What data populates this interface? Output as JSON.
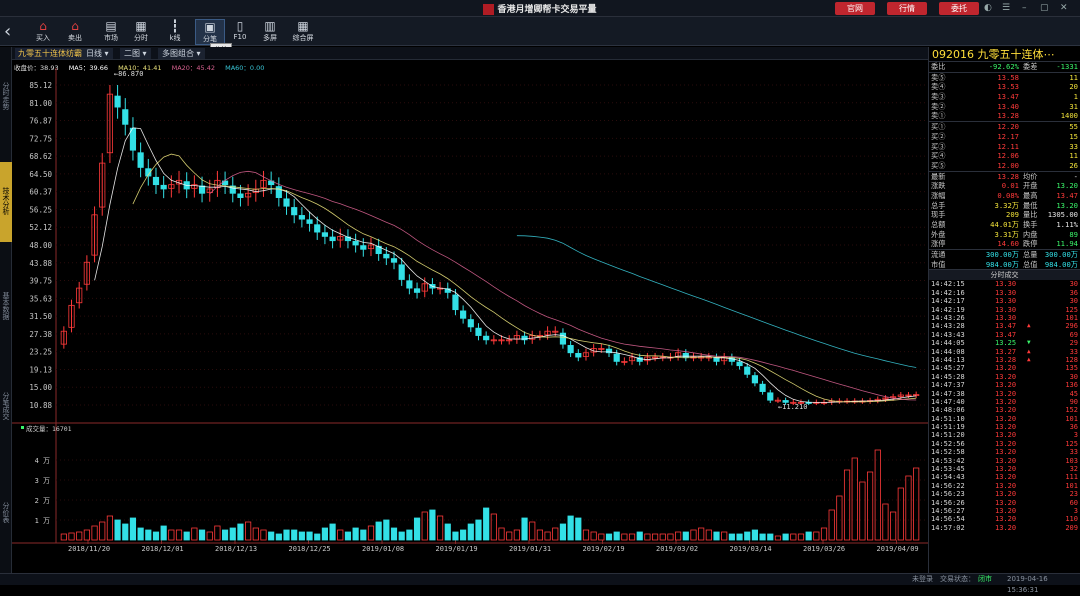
{
  "window": {
    "title": "香港月增卿帮卡交易平量",
    "buttons": [
      "官网",
      "行情",
      "委托"
    ],
    "controls": [
      "◐",
      "☰",
      "–",
      "▢",
      "✕"
    ]
  },
  "toolbar": {
    "items": [
      {
        "label": "买入",
        "icon": "buy-icon",
        "glyph": "⌂"
      },
      {
        "label": "卖出",
        "icon": "sell-icon",
        "glyph": "⌂"
      },
      {
        "label": "市场",
        "icon": "market-icon",
        "glyph": "▤"
      },
      {
        "label": "分时",
        "icon": "timeshare-icon",
        "glyph": "▦"
      },
      {
        "label": "k线",
        "icon": "kline-icon",
        "glyph": "┇"
      },
      {
        "label": "分笔",
        "icon": "tick-icon",
        "glyph": "▣"
      },
      {
        "label": "F10",
        "icon": "f10-icon",
        "glyph": "▯"
      },
      {
        "label": "多屏",
        "icon": "multiscreen-icon",
        "glyph": "▥"
      },
      {
        "label": "综合屏",
        "icon": "dashboard-icon",
        "glyph": "▦"
      }
    ],
    "tooltip": "分笔"
  },
  "leftnav": [
    "分时走势",
    "技术分析",
    "基本数据",
    "分笔成交",
    "分价表"
  ],
  "chart_tabs": {
    "stock": "九零五十连体纺霸",
    "period": "日线",
    "layout": "二图",
    "combo": "多图组合"
  },
  "legend": {
    "price": "收盘价：38.93",
    "ma5": "MA5：39.66",
    "ma10": "MA10：41.41",
    "ma20": "MA20：45.42",
    "ma60": "MA60：0.00",
    "volume": "成交量：16701"
  },
  "colors": {
    "up": "#ff3a3a",
    "down": "#33e0e6",
    "ma5": "#ffffff",
    "ma10": "#e8e07a",
    "ma20": "#d6618f",
    "ma60": "#39c6d6"
  },
  "chart_data": {
    "type": "candlestick",
    "price_ticks": [
      "85.12",
      "81.00",
      "76.87",
      "72.75",
      "68.62",
      "64.50",
      "60.37",
      "56.25",
      "52.12",
      "48.00",
      "43.88",
      "39.75",
      "35.63",
      "31.50",
      "27.38",
      "23.25",
      "19.13",
      "15.00",
      "10.88"
    ],
    "volume_ticks": [
      "4 万",
      "3 万",
      "2 万",
      "1 万"
    ],
    "date_ticks": [
      "2018/11/20",
      "2018/12/01",
      "2018/12/13",
      "2018/12/25",
      "2019/01/08",
      "2019/01/19",
      "2019/01/31",
      "2019/02/19",
      "2019/03/02",
      "2019/03/14",
      "2019/03/26",
      "2019/04/09"
    ],
    "annotations": {
      "high": "←86.870",
      "low": "←11.210"
    },
    "ylim": [
      10.88,
      85.12
    ],
    "closes": [
      28,
      34,
      38,
      44,
      55,
      67,
      83,
      80,
      76,
      70,
      66,
      64,
      62,
      61,
      62,
      63,
      61,
      62,
      60,
      61,
      63,
      62,
      60,
      59,
      60,
      61,
      63,
      62,
      59,
      57,
      55,
      54,
      53,
      51,
      50,
      49,
      50,
      49,
      48,
      47,
      48,
      46,
      45,
      44,
      40,
      38,
      37,
      39,
      38,
      38,
      37,
      33,
      31,
      29,
      27,
      26,
      26,
      26,
      26,
      27,
      26,
      27,
      27,
      28,
      28,
      25,
      23,
      22,
      23,
      24,
      24,
      23,
      21,
      21,
      22,
      21,
      22,
      22,
      22,
      22,
      23,
      22,
      22,
      22,
      22,
      21,
      22,
      21,
      20,
      18,
      16,
      14,
      12,
      12,
      11.5,
      11.5,
      11.5,
      11.3,
      11.5,
      11.5,
      11.8,
      11.8,
      11.8,
      11.8,
      11.8,
      11.9,
      12.2,
      12.5,
      12.8,
      13.2,
      13.2,
      13.3
    ],
    "volumes": [
      0.3,
      0.35,
      0.4,
      0.5,
      0.7,
      0.9,
      1.2,
      1.0,
      0.8,
      1.1,
      0.6,
      0.5,
      0.4,
      0.7,
      0.5,
      0.5,
      0.4,
      0.6,
      0.5,
      0.4,
      0.7,
      0.5,
      0.6,
      0.8,
      0.9,
      0.6,
      0.5,
      0.4,
      0.3,
      0.5,
      0.5,
      0.4,
      0.4,
      0.3,
      0.6,
      0.8,
      0.5,
      0.4,
      0.6,
      0.5,
      0.7,
      0.9,
      1.0,
      0.6,
      0.4,
      0.5,
      1.1,
      1.4,
      1.5,
      1.2,
      0.8,
      0.4,
      0.5,
      0.8,
      1.0,
      1.6,
      1.3,
      0.6,
      0.4,
      0.5,
      1.1,
      0.9,
      0.5,
      0.4,
      0.6,
      0.8,
      1.2,
      1.1,
      0.5,
      0.4,
      0.3,
      0.3,
      0.4,
      0.3,
      0.3,
      0.4,
      0.3,
      0.3,
      0.3,
      0.3,
      0.4,
      0.4,
      0.5,
      0.6,
      0.5,
      0.4,
      0.4,
      0.3,
      0.3,
      0.4,
      0.5,
      0.3,
      0.3,
      0.2,
      0.3,
      0.3,
      0.3,
      0.4,
      0.4,
      0.6,
      1.5,
      2.2,
      3.5,
      4.1,
      2.9,
      3.4,
      4.5,
      1.8,
      1.4,
      2.6,
      3.2,
      3.6
    ]
  },
  "right_panel": {
    "code_name": "092016 九零五十连体⋯",
    "weibi": {
      "label": "委比",
      "value": "-92.62%",
      "label2": "委差",
      "value2": "-1331"
    },
    "asks": [
      {
        "label": "卖⑤",
        "price": "13.58",
        "vol": "11"
      },
      {
        "label": "卖④",
        "price": "13.53",
        "vol": "20"
      },
      {
        "label": "卖③",
        "price": "13.47",
        "vol": "1"
      },
      {
        "label": "卖②",
        "price": "13.40",
        "vol": "31"
      },
      {
        "label": "卖①",
        "price": "13.28",
        "vol": "1400"
      }
    ],
    "bids": [
      {
        "label": "买①",
        "price": "12.20",
        "vol": "55"
      },
      {
        "label": "买②",
        "price": "12.17",
        "vol": "15"
      },
      {
        "label": "买③",
        "price": "12.11",
        "vol": "33"
      },
      {
        "label": "买④",
        "price": "12.06",
        "vol": "11"
      },
      {
        "label": "买⑤",
        "price": "12.00",
        "vol": "26"
      }
    ],
    "stats": [
      {
        "l1": "最新",
        "v1": "13.28",
        "c1": "r",
        "l2": "均价",
        "v2": "-",
        "c2": "w"
      },
      {
        "l1": "涨跌",
        "v1": "0.01",
        "c1": "r",
        "l2": "开盘",
        "v2": "13.20",
        "c2": "g"
      },
      {
        "l1": "涨幅",
        "v1": "0.08%",
        "c1": "r",
        "l2": "最高",
        "v2": "13.47",
        "c2": "r"
      },
      {
        "l1": "总手",
        "v1": "3.32万",
        "c1": "y",
        "l2": "最低",
        "v2": "13.20",
        "c2": "g"
      },
      {
        "l1": "现手",
        "v1": "209",
        "c1": "y",
        "l2": "量比",
        "v2": "1305.00",
        "c2": "w"
      },
      {
        "l1": "总额",
        "v1": "44.01万",
        "c1": "y",
        "l2": "换手",
        "v2": "1.11%",
        "c2": "w"
      },
      {
        "l1": "外盘",
        "v1": "3.31万",
        "c1": "y",
        "l2": "内盘",
        "v2": "89",
        "c2": "g"
      },
      {
        "l1": "涨停",
        "v1": "14.60",
        "c1": "r",
        "l2": "跌停",
        "v2": "11.94",
        "c2": "g"
      }
    ],
    "caps": [
      {
        "l1": "流通",
        "v1": "300.00万",
        "l2": "总量",
        "v2": "300.00万"
      },
      {
        "l1": "市值",
        "v1": "984.00万",
        "l2": "总值",
        "v2": "984.00万"
      }
    ],
    "ticks_title": "分时成交",
    "ticks": [
      {
        "t": "14:42:15",
        "p": "13.30",
        "v": "30",
        "a": ""
      },
      {
        "t": "14:42:16",
        "p": "13.30",
        "v": "36",
        "a": ""
      },
      {
        "t": "14:42:17",
        "p": "13.30",
        "v": "30",
        "a": ""
      },
      {
        "t": "14:42:19",
        "p": "13.30",
        "v": "125",
        "a": ""
      },
      {
        "t": "14:43:26",
        "p": "13.30",
        "v": "101",
        "a": ""
      },
      {
        "t": "14:43:28",
        "p": "13.47",
        "v": "296",
        "a": "up"
      },
      {
        "t": "14:43:43",
        "p": "13.47",
        "v": "69",
        "a": ""
      },
      {
        "t": "14:44:05",
        "p": "13.25",
        "v": "29",
        "a": "down"
      },
      {
        "t": "14:44:08",
        "p": "13.27",
        "v": "33",
        "a": "up"
      },
      {
        "t": "14:44:13",
        "p": "13.28",
        "v": "128",
        "a": "up"
      },
      {
        "t": "14:45:27",
        "p": "13.20",
        "v": "135",
        "a": ""
      },
      {
        "t": "14:45:28",
        "p": "13.20",
        "v": "30",
        "a": ""
      },
      {
        "t": "14:47:37",
        "p": "13.20",
        "v": "136",
        "a": ""
      },
      {
        "t": "14:47:38",
        "p": "13.20",
        "v": "45",
        "a": ""
      },
      {
        "t": "14:47:40",
        "p": "13.20",
        "v": "90",
        "a": ""
      },
      {
        "t": "14:48:06",
        "p": "13.20",
        "v": "152",
        "a": ""
      },
      {
        "t": "14:51:10",
        "p": "13.20",
        "v": "101",
        "a": ""
      },
      {
        "t": "14:51:19",
        "p": "13.20",
        "v": "36",
        "a": ""
      },
      {
        "t": "14:51:20",
        "p": "13.20",
        "v": "3",
        "a": ""
      },
      {
        "t": "14:52:56",
        "p": "13.20",
        "v": "125",
        "a": ""
      },
      {
        "t": "14:52:58",
        "p": "13.20",
        "v": "33",
        "a": ""
      },
      {
        "t": "14:53:42",
        "p": "13.20",
        "v": "103",
        "a": ""
      },
      {
        "t": "14:53:45",
        "p": "13.20",
        "v": "32",
        "a": ""
      },
      {
        "t": "14:54:43",
        "p": "13.20",
        "v": "111",
        "a": ""
      },
      {
        "t": "14:56:22",
        "p": "13.20",
        "v": "101",
        "a": ""
      },
      {
        "t": "14:56:23",
        "p": "13.20",
        "v": "23",
        "a": ""
      },
      {
        "t": "14:56:26",
        "p": "13.20",
        "v": "60",
        "a": ""
      },
      {
        "t": "14:56:27",
        "p": "13.20",
        "v": "3",
        "a": ""
      },
      {
        "t": "14:56:54",
        "p": "13.20",
        "v": "110",
        "a": ""
      },
      {
        "t": "14:57:02",
        "p": "13.20",
        "v": "209",
        "a": ""
      }
    ]
  },
  "status": {
    "login": "未登录",
    "conn_label": "交易状态：",
    "conn": "闭市",
    "time": "2019-04-16 15:36:31"
  }
}
